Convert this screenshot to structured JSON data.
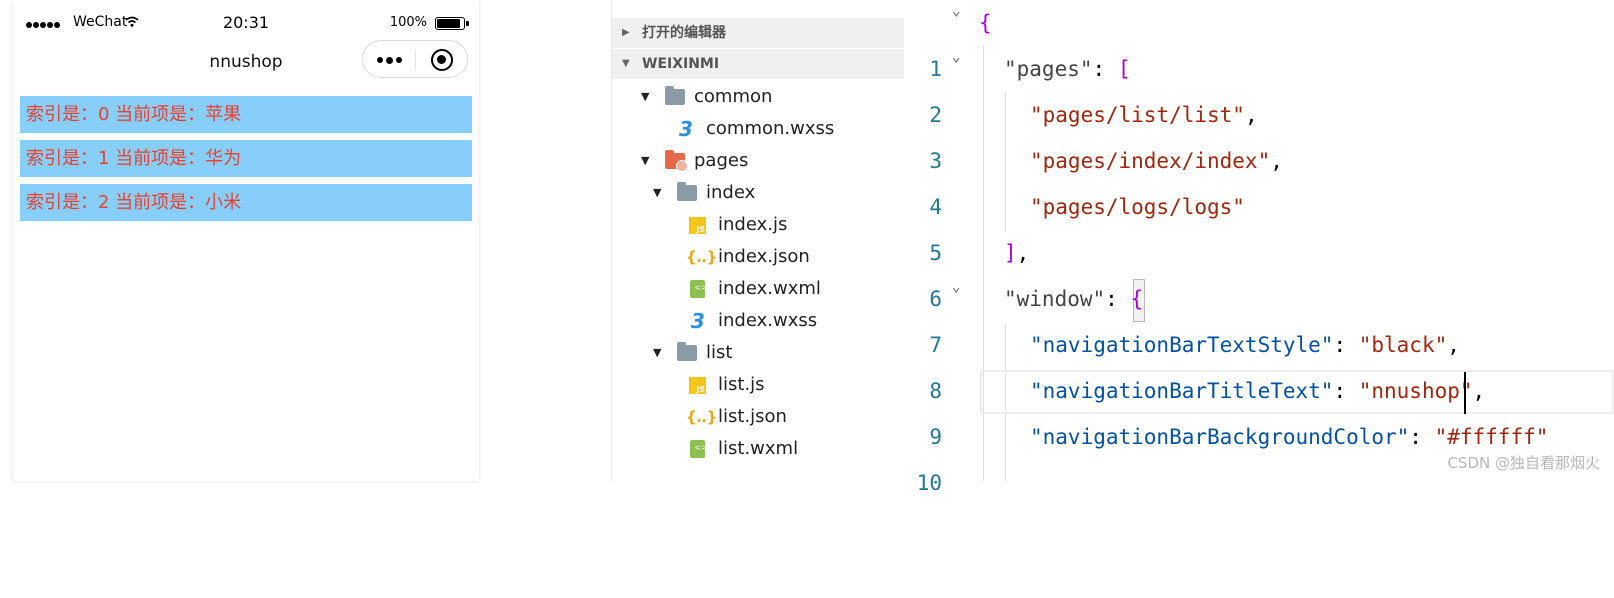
{
  "simulator": {
    "status_bar": {
      "carrier": "WeChat",
      "time": "20:31",
      "battery": "100%"
    },
    "nav_title": "nnushop",
    "list_items": [
      "索引是：0 当前项是：苹果",
      "索引是：1 当前项是：华为",
      "索引是：2 当前项是：小米"
    ],
    "list_bg_color": "#87cefa",
    "list_text_color": "#e8412f"
  },
  "explorer": {
    "sections": [
      {
        "label": "打开的编辑器",
        "expanded": false
      },
      {
        "label": "WEIXINMI",
        "expanded": true
      }
    ],
    "tree": [
      {
        "name": "common",
        "type": "folder",
        "icon": "folder-icon",
        "expanded": true
      },
      {
        "name": "common.wxss",
        "type": "file",
        "icon": "wxss-icon"
      },
      {
        "name": "pages",
        "type": "folder",
        "icon": "pages-folder-icon",
        "expanded": true
      },
      {
        "name": "index",
        "type": "folder",
        "icon": "folder-icon",
        "expanded": true
      },
      {
        "name": "index.js",
        "type": "file",
        "icon": "js-icon"
      },
      {
        "name": "index.json",
        "type": "file",
        "icon": "json-icon"
      },
      {
        "name": "index.wxml",
        "type": "file",
        "icon": "wxml-icon"
      },
      {
        "name": "index.wxss",
        "type": "file",
        "icon": "wxss-icon"
      },
      {
        "name": "list",
        "type": "folder",
        "icon": "folder-icon",
        "expanded": true
      },
      {
        "name": "list.js",
        "type": "file",
        "icon": "js-icon"
      },
      {
        "name": "list.json",
        "type": "file",
        "icon": "json-icon"
      },
      {
        "name": "list.wxml",
        "type": "file",
        "icon": "wxml-icon"
      }
    ]
  },
  "editor": {
    "line_numbers": [
      "1",
      "2",
      "3",
      "4",
      "5",
      "6",
      "7",
      "8",
      "9",
      "10"
    ],
    "lines": {
      "l1_brace": "{",
      "l2_key": "\"pages\"",
      "l2_colon": ": ",
      "l2_bracket": "[",
      "l3": "\"pages/list/list\"",
      "l4": "\"pages/index/index\"",
      "l5": "\"pages/logs/logs\"",
      "l6_bracket": "]",
      "l7_key": "\"window\"",
      "l7_brace": "{",
      "l8_key": "\"navigationBarTextStyle\"",
      "l8_val": "\"black\"",
      "l9_key": "\"navigationBarTitleText\"",
      "l9_val": "\"nnushop\"",
      "l10_key": "\"navigationBarBackgroundColor\"",
      "l10_val": "\"#ffffff\""
    },
    "comma": ",",
    "colon": ": "
  },
  "watermark": "CSDN @独自看那烟火"
}
